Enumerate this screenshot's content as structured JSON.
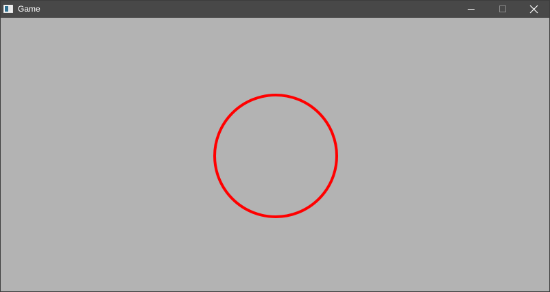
{
  "window": {
    "title": "Game",
    "app_icon": "window-app-icon",
    "controls": {
      "minimize_icon": "minimize-icon",
      "maximize_icon": "maximize-icon",
      "close_icon": "close-icon"
    }
  },
  "colors": {
    "titlebar": "#484848",
    "canvas_background": "#b3b3b3",
    "circle_stroke": "#ff0000",
    "disabled_control": "#8a8a8a"
  },
  "game": {
    "shapes": [
      {
        "type": "circle-outline",
        "color": "#ff0000"
      }
    ]
  }
}
